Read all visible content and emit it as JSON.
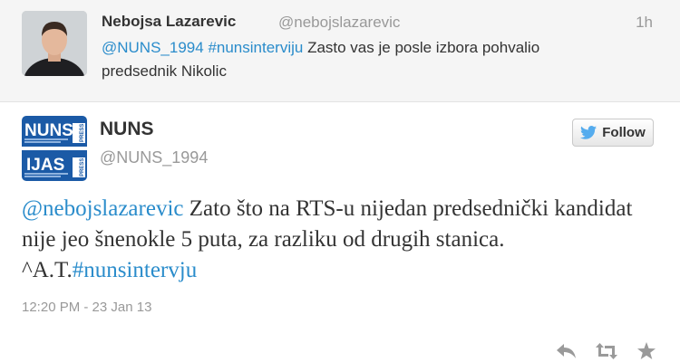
{
  "parent_tweet": {
    "name": "Nebojsa Lazarevic",
    "handle": "@nebojslazarevic",
    "time": "1h",
    "mention": "@NUNS_1994",
    "hashtag": "#nunsinterviju",
    "text_rest": " Zasto vas je posle izbora pohvalio predsednik Nikolic"
  },
  "main_tweet": {
    "name": "NUNS",
    "handle": "@NUNS_1994",
    "follow_label": "Follow",
    "mention": "@nebojslazarevic",
    "text_body": " Zato što na RTS-u nijedan predsednički kandidat nije jeo šnenokle 5 puta, za razliku od drugih stanica. ^A.T.",
    "hashtag": "#nunsintervju",
    "timestamp": "12:20 PM - 23 Jan 13"
  },
  "logo": {
    "top_word": "NUNS",
    "bottom_word": "IJAS",
    "badge": "PRESS"
  },
  "colors": {
    "link": "#2a8ccb",
    "logo_blue": "#1b5aa6",
    "twitter_bird": "#55acee"
  },
  "icons": [
    "reply-icon",
    "retweet-icon",
    "favorite-icon",
    "twitter-bird-icon"
  ]
}
